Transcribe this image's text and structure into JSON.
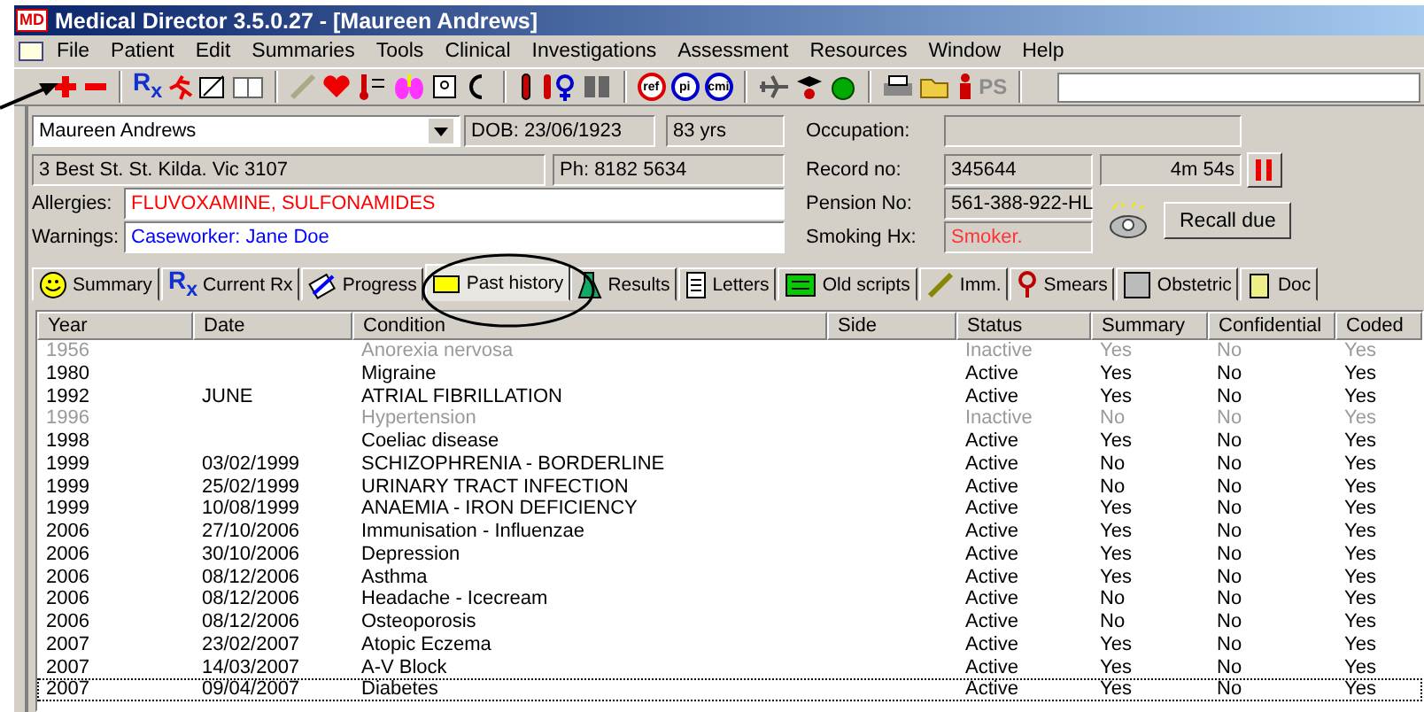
{
  "window": {
    "logo": "MD",
    "title": "Medical Director 3.5.0.27 - [Maureen Andrews]"
  },
  "menu": [
    "File",
    "Patient",
    "Edit",
    "Summaries",
    "Tools",
    "Clinical",
    "Investigations",
    "Assessment",
    "Resources",
    "Window",
    "Help"
  ],
  "toolbar": {
    "rx": "R$_{x}$",
    "circle_buttons": [
      "ref",
      "pi",
      "cmi"
    ],
    "ps": "PS",
    "ps_disabled": true
  },
  "patient": {
    "name": "Maureen Andrews",
    "dob": "DOB: 23/06/1923",
    "age": "83 yrs",
    "address": "3 Best St. St. Kilda. Vic  3107",
    "phone": "Ph: 8182 5634",
    "allergies_label": "Allergies:",
    "allergies": "FLUVOXAMINE, SULFONAMIDES",
    "warnings_label": "Warnings:",
    "warnings": "Caseworker:  Jane Doe",
    "occupation_label": "Occupation:",
    "record_label": "Record no:",
    "record": "345644",
    "pension_label": "Pension No:",
    "pension": "561-388-922-HL",
    "smoking_label": "Smoking Hx:",
    "smoking": "Smoker.",
    "timer": "4m 54s",
    "recall_button": "Recall due"
  },
  "tabs": [
    {
      "label": "Summary",
      "selected": false
    },
    {
      "label": "Current Rx",
      "selected": false,
      "icon_text": "R$_{x}$"
    },
    {
      "label": "Progress",
      "selected": false
    },
    {
      "label": "Past history",
      "selected": true
    },
    {
      "label": "Results",
      "selected": false
    },
    {
      "label": "Letters",
      "selected": false
    },
    {
      "label": "Old scripts",
      "selected": false
    },
    {
      "label": "Imm.",
      "selected": false
    },
    {
      "label": "Smears",
      "selected": false
    },
    {
      "label": "Obstetric",
      "selected": false
    },
    {
      "label": "Doc",
      "selected": false
    }
  ],
  "table": {
    "columns": [
      "Year",
      "Date",
      "Condition",
      "Side",
      "Status",
      "Summary",
      "Confidential",
      "Coded"
    ],
    "rows": [
      {
        "year": "1956",
        "date": "",
        "condition": "Anorexia nervosa",
        "status": "Inactive",
        "summary": "Yes",
        "confidential": "No",
        "coded": "Yes",
        "inactive": true,
        "focused": false
      },
      {
        "year": "1980",
        "date": "",
        "condition": "Migraine",
        "status": "Active",
        "summary": "Yes",
        "confidential": "No",
        "coded": "Yes",
        "inactive": false,
        "focused": false
      },
      {
        "year": "1992",
        "date": "JUNE",
        "condition": "ATRIAL FIBRILLATION",
        "status": "Active",
        "summary": "Yes",
        "confidential": "No",
        "coded": "Yes",
        "inactive": false,
        "focused": false
      },
      {
        "year": "1996",
        "date": "",
        "condition": "Hypertension",
        "status": "Inactive",
        "summary": "No",
        "confidential": "No",
        "coded": "Yes",
        "inactive": true,
        "focused": false
      },
      {
        "year": "1998",
        "date": "",
        "condition": "Coeliac disease",
        "status": "Active",
        "summary": "Yes",
        "confidential": "No",
        "coded": "Yes",
        "inactive": false,
        "focused": false
      },
      {
        "year": "1999",
        "date": "03/02/1999",
        "condition": "SCHIZOPHRENIA - BORDERLINE",
        "status": "Active",
        "summary": "No",
        "confidential": "No",
        "coded": "Yes",
        "inactive": false,
        "focused": false
      },
      {
        "year": "1999",
        "date": "25/02/1999",
        "condition": "URINARY TRACT INFECTION",
        "status": "Active",
        "summary": "No",
        "confidential": "No",
        "coded": "Yes",
        "inactive": false,
        "focused": false
      },
      {
        "year": "1999",
        "date": "10/08/1999",
        "condition": "ANAEMIA - IRON DEFICIENCY",
        "status": "Active",
        "summary": "Yes",
        "confidential": "No",
        "coded": "Yes",
        "inactive": false,
        "focused": false
      },
      {
        "year": "2006",
        "date": "27/10/2006",
        "condition": "Immunisation - Influenzae",
        "status": "Active",
        "summary": "Yes",
        "confidential": "No",
        "coded": "Yes",
        "inactive": false,
        "focused": false
      },
      {
        "year": "2006",
        "date": "30/10/2006",
        "condition": "Depression",
        "status": "Active",
        "summary": "Yes",
        "confidential": "No",
        "coded": "Yes",
        "inactive": false,
        "focused": false
      },
      {
        "year": "2006",
        "date": "08/12/2006",
        "condition": "Asthma",
        "status": "Active",
        "summary": "Yes",
        "confidential": "No",
        "coded": "Yes",
        "inactive": false,
        "focused": false
      },
      {
        "year": "2006",
        "date": "08/12/2006",
        "condition": "Headache - Icecream",
        "status": "Active",
        "summary": "No",
        "confidential": "No",
        "coded": "Yes",
        "inactive": false,
        "focused": false
      },
      {
        "year": "2006",
        "date": "08/12/2006",
        "condition": "Osteoporosis",
        "status": "Active",
        "summary": "No",
        "confidential": "No",
        "coded": "Yes",
        "inactive": false,
        "focused": false
      },
      {
        "year": "2007",
        "date": "23/02/2007",
        "condition": "Atopic Eczema",
        "status": "Active",
        "summary": "Yes",
        "confidential": "No",
        "coded": "Yes",
        "inactive": false,
        "focused": false
      },
      {
        "year": "2007",
        "date": "14/03/2007",
        "condition": "A-V Block",
        "status": "Active",
        "summary": "Yes",
        "confidential": "No",
        "coded": "Yes",
        "inactive": false,
        "focused": false
      },
      {
        "year": "2007",
        "date": "09/04/2007",
        "condition": "Diabetes",
        "status": "Active",
        "summary": "Yes",
        "confidential": "No",
        "coded": "Yes",
        "inactive": false,
        "focused": true
      }
    ]
  }
}
